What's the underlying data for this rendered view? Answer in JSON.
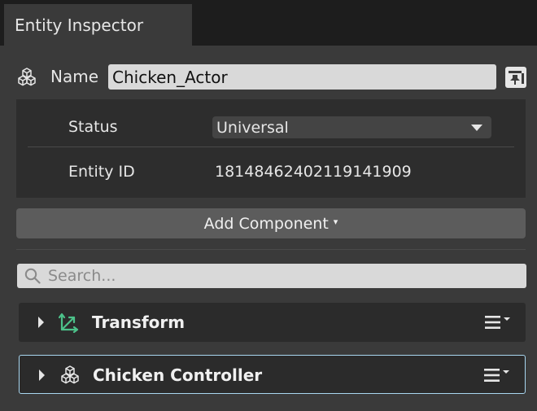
{
  "tab": {
    "title": "Entity Inspector"
  },
  "name_row": {
    "label": "Name",
    "value": "Chicken_Actor"
  },
  "properties": {
    "status_label": "Status",
    "status_value": "Universal",
    "entity_id_label": "Entity ID",
    "entity_id_value": "18148462402119141909"
  },
  "add_component": {
    "label": "Add Component",
    "caret": "▾"
  },
  "search": {
    "placeholder": "Search..."
  },
  "components": [
    {
      "title": "Transform",
      "icon": "transform-icon"
    },
    {
      "title": "Chicken Controller",
      "icon": "cube-icon"
    }
  ],
  "colors": {
    "panel_bg": "#3a3a3a",
    "tabbar_bg": "#1d1d1d",
    "props_bg": "#2d2d2d",
    "component_bg": "#2b2b2b",
    "selection_border": "#a8d6f0",
    "transform_icon": "#4cc28a"
  }
}
